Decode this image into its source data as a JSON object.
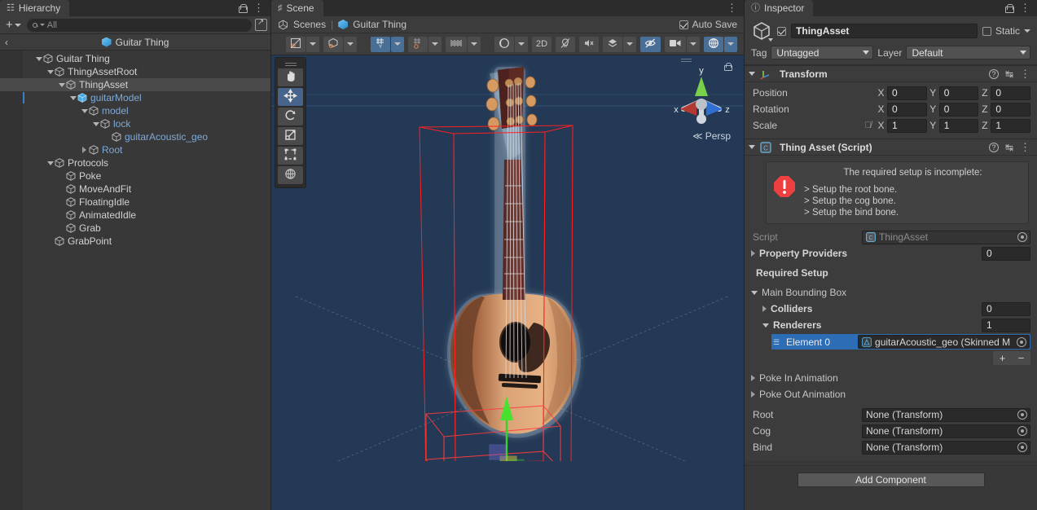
{
  "hierarchy": {
    "tab_label": "Hierarchy",
    "tab_icon": "hierarchy-icon",
    "search_placeholder": "All",
    "breadcrumb_label": "Guitar Thing",
    "items": [
      {
        "label": "Guitar Thing",
        "depth": 1,
        "arrow": "down",
        "prefab": false,
        "selected": false,
        "icon": "gameobject-cube-icon"
      },
      {
        "label": "ThingAssetRoot",
        "depth": 2,
        "arrow": "down",
        "prefab": false,
        "selected": false,
        "icon": "gameobject-cube-icon"
      },
      {
        "label": "ThingAsset",
        "depth": 3,
        "arrow": "down",
        "prefab": false,
        "selected": true,
        "icon": "gameobject-cube-icon"
      },
      {
        "label": "guitarModel",
        "depth": 4,
        "arrow": "down",
        "prefab": true,
        "selected": false,
        "icon": "prefab-cube-icon"
      },
      {
        "label": "model",
        "depth": 5,
        "arrow": "down",
        "prefab": true,
        "selected": false,
        "icon": "gameobject-cube-icon"
      },
      {
        "label": "lock",
        "depth": 6,
        "arrow": "down",
        "prefab": true,
        "selected": false,
        "icon": "gameobject-cube-icon"
      },
      {
        "label": "guitarAcoustic_geo",
        "depth": 7,
        "arrow": "none",
        "prefab": true,
        "selected": false,
        "icon": "gameobject-cube-icon"
      },
      {
        "label": "Root",
        "depth": 5,
        "arrow": "right",
        "prefab": true,
        "selected": false,
        "icon": "gameobject-cube-icon"
      },
      {
        "label": "Protocols",
        "depth": 2,
        "arrow": "down",
        "prefab": false,
        "selected": false,
        "icon": "gameobject-cube-icon"
      },
      {
        "label": "Poke",
        "depth": 3,
        "arrow": "none",
        "prefab": false,
        "selected": false,
        "icon": "gameobject-cube-icon"
      },
      {
        "label": "MoveAndFit",
        "depth": 3,
        "arrow": "none",
        "prefab": false,
        "selected": false,
        "icon": "gameobject-cube-icon"
      },
      {
        "label": "FloatingIdle",
        "depth": 3,
        "arrow": "none",
        "prefab": false,
        "selected": false,
        "icon": "gameobject-cube-icon"
      },
      {
        "label": "AnimatedIdle",
        "depth": 3,
        "arrow": "none",
        "prefab": false,
        "selected": false,
        "icon": "gameobject-cube-icon"
      },
      {
        "label": "Grab",
        "depth": 3,
        "arrow": "none",
        "prefab": false,
        "selected": false,
        "icon": "gameobject-cube-icon"
      },
      {
        "label": "GrabPoint",
        "depth": 2,
        "arrow": "none",
        "prefab": false,
        "selected": false,
        "icon": "gameobject-cube-icon"
      }
    ]
  },
  "scene": {
    "tab_label": "Scene",
    "scenes_label": "Scenes",
    "stage_label": "Guitar Thing",
    "autosave_label": "Auto Save",
    "autosave_checked": true,
    "toolbar": [
      {
        "name": "draw-mode-shaded",
        "glyph": "shaded",
        "dropdown": true,
        "active": false
      },
      {
        "name": "scene-visibility-cam",
        "glyph": "cubecam",
        "dropdown": true,
        "active": false
      },
      {
        "name": "grid-visibility",
        "glyph": "gridy",
        "dropdown": true,
        "active": true
      },
      {
        "name": "grid-snapping",
        "glyph": "gridsnap",
        "dropdown": true,
        "active": false
      },
      {
        "name": "snap-increment",
        "glyph": "ruler",
        "dropdown": true,
        "active": false
      },
      {
        "name": "scene-lighting",
        "glyph": "moon",
        "dropdown": true,
        "active": false
      },
      {
        "name": "toggle-2d",
        "glyph": "2D",
        "dropdown": false,
        "active": false
      },
      {
        "name": "scene-lighting-toggle",
        "glyph": "bulb",
        "dropdown": false,
        "active": false
      },
      {
        "name": "scene-audio-toggle",
        "glyph": "speaker",
        "dropdown": false,
        "active": false
      },
      {
        "name": "fx-toggle",
        "glyph": "fx",
        "dropdown": true,
        "active": false
      },
      {
        "name": "scene-visibility-toggle",
        "glyph": "eyeoff",
        "dropdown": false,
        "active": true
      },
      {
        "name": "camera-settings",
        "glyph": "camera",
        "dropdown": true,
        "active": false
      },
      {
        "name": "gizmos-toggle",
        "glyph": "gizmo",
        "dropdown": true,
        "active": true
      }
    ],
    "tools_overlay": [
      {
        "name": "view-tool",
        "glyph": "hand",
        "active": false
      },
      {
        "name": "move-tool",
        "glyph": "move",
        "active": true
      },
      {
        "name": "rotate-tool",
        "glyph": "rotate",
        "active": false
      },
      {
        "name": "scale-tool",
        "glyph": "scale",
        "active": false
      },
      {
        "name": "rect-tool",
        "glyph": "rect",
        "active": false
      },
      {
        "name": "transform-tool",
        "glyph": "transform",
        "active": false
      }
    ],
    "gizmo": {
      "x_label": "x",
      "y_label": "y",
      "z_label": "z",
      "projection_label": "Persp"
    }
  },
  "inspector": {
    "tab_label": "Inspector",
    "object_name": "ThingAsset",
    "object_enabled": true,
    "static_label": "Static",
    "static_checked": false,
    "tag_label": "Tag",
    "tag_value": "Untagged",
    "layer_label": "Layer",
    "layer_value": "Default",
    "transform": {
      "title": "Transform",
      "rows": [
        {
          "label": "Position",
          "x": "0",
          "y": "0",
          "z": "0",
          "eye": false
        },
        {
          "label": "Rotation",
          "x": "0",
          "y": "0",
          "z": "0",
          "eye": false
        },
        {
          "label": "Scale",
          "x": "1",
          "y": "1",
          "z": "1",
          "eye": true
        }
      ]
    },
    "thing_asset": {
      "title": "Thing Asset (Script)",
      "help_title": "The required setup is incomplete:",
      "help_items": [
        "> Setup the root bone.",
        "> Setup the cog bone.",
        "> Setup the bind bone."
      ],
      "script_label": "Script",
      "script_value": "ThingAsset",
      "property_providers_label": "Property Providers",
      "property_providers_count": "0",
      "required_setup_label": "Required Setup",
      "main_bounding_box_label": "Main Bounding Box",
      "colliders_label": "Colliders",
      "colliders_count": "0",
      "renderers_label": "Renderers",
      "renderers_count": "1",
      "renderer_element_label": "Element 0",
      "renderer_element_value": "guitarAcoustic_geo (Skinned M",
      "add_element_label": "+",
      "remove_element_label": "−",
      "poke_in_label": "Poke In Animation",
      "poke_out_label": "Poke Out Animation",
      "root_label": "Root",
      "root_value": "None (Transform)",
      "cog_label": "Cog",
      "cog_value": "None (Transform)",
      "bind_label": "Bind",
      "bind_value": "None (Transform)"
    },
    "add_component_label": "Add Component"
  },
  "colors": {
    "panel_bg": "#383838",
    "header_bg": "#3c3c3c",
    "tabbar_bg": "#2c2c2c",
    "scene_bg": "#233955",
    "accent_blue": "#2c6db5",
    "toolbar_active": "#4a6f96",
    "error_red": "#ee4040",
    "prefab_blue": "#7fa9d8",
    "gizmo_x": "#c4352f",
    "gizmo_y": "#5fd22e",
    "gizmo_z": "#2f6fd2"
  }
}
